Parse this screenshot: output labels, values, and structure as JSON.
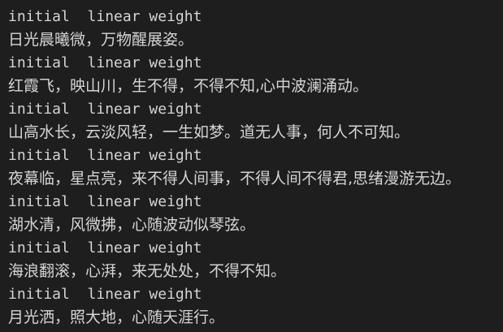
{
  "console": {
    "entries": [
      {
        "label": "initial  linear weight",
        "text": "日光晨曦微，万物醒展姿。"
      },
      {
        "label": "initial  linear weight",
        "text": "红霞飞，映山川，生不得，不得不知,心中波澜涌动。"
      },
      {
        "label": "initial  linear weight",
        "text": "山高水长，云淡风轻，一生如梦。道无人事，何人不可知。"
      },
      {
        "label": "initial  linear weight",
        "text": "夜幕临，星点亮，来不得人间事，不得人间不得君,思绪漫游无边。"
      },
      {
        "label": "initial  linear weight",
        "text": "湖水清，风微拂，心随波动似琴弦。"
      },
      {
        "label": "initial  linear weight",
        "text": "海浪翻滚，心湃，来无处处，不得不知。"
      },
      {
        "label": "initial  linear weight",
        "text": "月光洒，照大地，心随天涯行。"
      }
    ]
  }
}
